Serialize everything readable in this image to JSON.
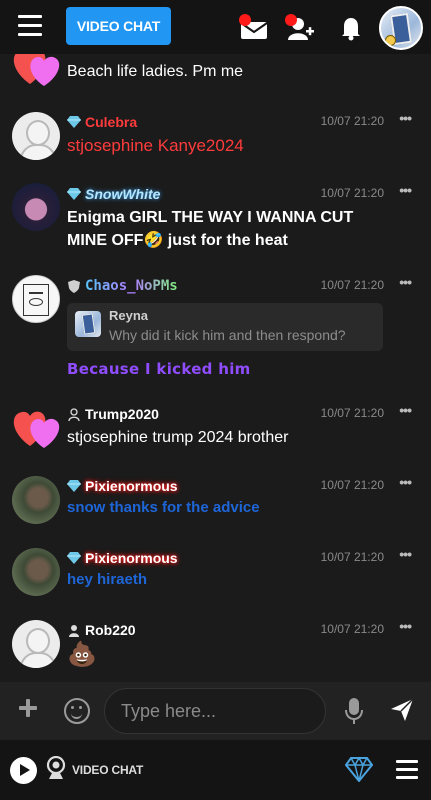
{
  "header": {
    "video_chat_label": "VIDEO CHAT",
    "icons": [
      "menu-icon",
      "mail-icon",
      "add-friend-icon",
      "bell-icon"
    ],
    "badge_color": "#ff1a1a"
  },
  "messages": [
    {
      "username": "",
      "text": "Beach life ladies. Pm me",
      "time": "",
      "rank": "none",
      "avatar": "heart-icon"
    },
    {
      "username": "Culebra",
      "text": "stjosephine Kanye2024",
      "time": "10/07 21:20",
      "rank": "diamond",
      "name_color": "#ff3b3b",
      "text_color": "#ff3b3b",
      "avatar": "default-avatar"
    },
    {
      "username": "SnowWhite",
      "text": "Enigma GIRL THE WAY I WANNA CUT MINE OFF🤣 just for the heat",
      "time": "10/07 21:20",
      "rank": "diamond",
      "name_color": "#b5e8ff",
      "text_color": "#ffffff",
      "avatar": "photo-avatar"
    },
    {
      "username": "Chaos_NoPMs",
      "reply_name": "Reyna",
      "reply_text": "Why did it kick him and then respond?",
      "text": "Because I kicked him",
      "time": "10/07 21:20",
      "rank": "shield",
      "text_color": "#8f4dff",
      "avatar": "sketch-avatar"
    },
    {
      "username": "Trump2020",
      "text": "stjosephine trump 2024 brother",
      "time": "10/07 21:20",
      "rank": "user",
      "name_color": "#ffffff",
      "text_color": "#ffffff",
      "avatar": "heart-icon"
    },
    {
      "username": "Pixienormous",
      "text": "snow thanks for the advice",
      "time": "10/07 21:20",
      "rank": "diamond",
      "name_color": "#ffffff",
      "text_color": "#1e66d8",
      "avatar": "photo-avatar"
    },
    {
      "username": "Pixienormous",
      "text": "hey hiraeth",
      "time": "10/07 21:20",
      "rank": "diamond",
      "name_color": "#ffffff",
      "text_color": "#1e66d8",
      "avatar": "photo-avatar"
    },
    {
      "username": "Rob220",
      "text": "💩",
      "time": "10/07 21:20",
      "rank": "user",
      "name_color": "#ffffff",
      "text_color": "#ffffff",
      "avatar": "default-avatar"
    }
  ],
  "composer": {
    "placeholder": "Type here..."
  },
  "footer": {
    "video_chat_label": "VIDEO CHAT"
  }
}
